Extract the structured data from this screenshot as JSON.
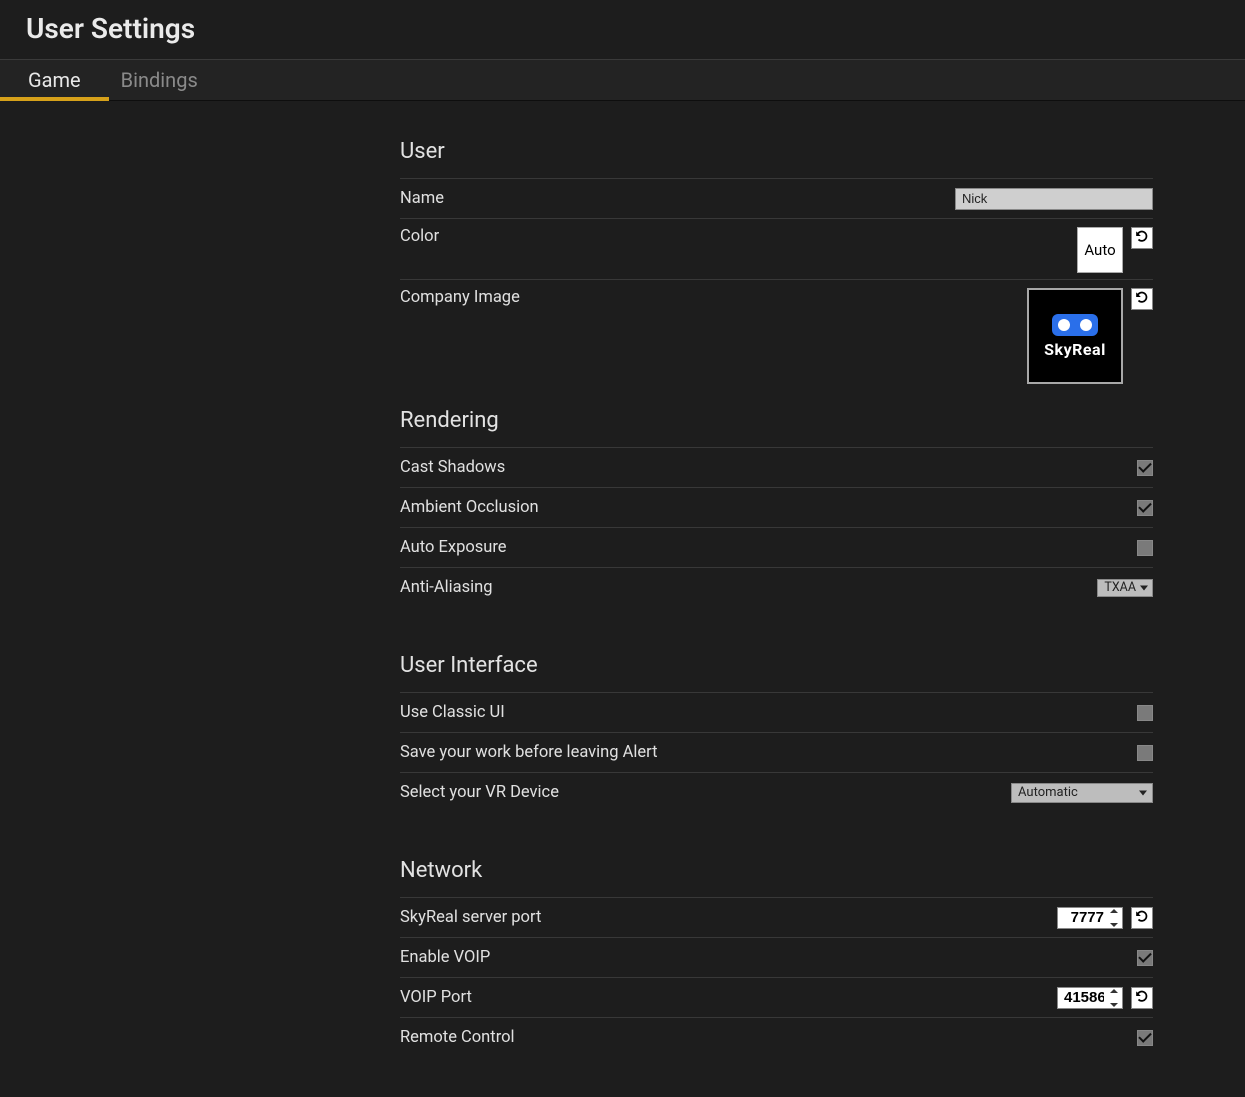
{
  "title": "User Settings",
  "tabs": [
    "Game",
    "Bindings"
  ],
  "activeTab": 0,
  "sections": {
    "user": {
      "title": "User",
      "name_label": "Name",
      "name_value": "Nick",
      "color_label": "Color",
      "color_value": "Auto",
      "company_image_label": "Company Image",
      "company_image_brand": "SkyReal"
    },
    "rendering": {
      "title": "Rendering",
      "cast_shadows_label": "Cast Shadows",
      "cast_shadows_checked": true,
      "ambient_occlusion_label": "Ambient Occlusion",
      "ambient_occlusion_checked": true,
      "auto_exposure_label": "Auto Exposure",
      "auto_exposure_checked": false,
      "anti_aliasing_label": "Anti-Aliasing",
      "anti_aliasing_value": "TXAA"
    },
    "ui": {
      "title": "User Interface",
      "classic_ui_label": "Use Classic UI",
      "classic_ui_checked": false,
      "save_alert_label": "Save your work before leaving Alert",
      "save_alert_checked": false,
      "vr_device_label": "Select your VR Device",
      "vr_device_value": "Automatic"
    },
    "network": {
      "title": "Network",
      "server_port_label": "SkyReal server port",
      "server_port_value": "7777",
      "enable_voip_label": "Enable VOIP",
      "enable_voip_checked": true,
      "voip_port_label": "VOIP Port",
      "voip_port_value": "41586",
      "remote_control_label": "Remote Control",
      "remote_control_checked": true
    }
  }
}
